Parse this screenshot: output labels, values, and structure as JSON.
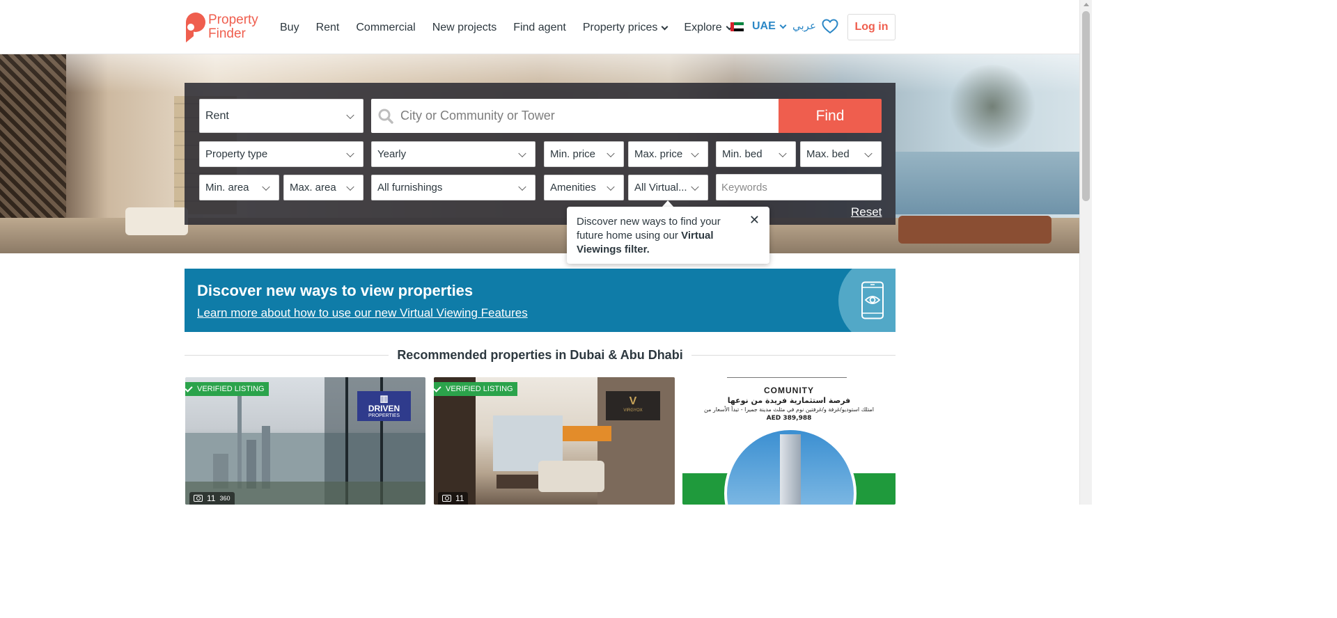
{
  "header": {
    "logo": {
      "line1": "Property",
      "line2": "Finder"
    },
    "nav": [
      {
        "label": "Buy",
        "dropdown": false
      },
      {
        "label": "Rent",
        "dropdown": false
      },
      {
        "label": "Commercial",
        "dropdown": false
      },
      {
        "label": "New projects",
        "dropdown": false
      },
      {
        "label": "Find agent",
        "dropdown": false
      },
      {
        "label": "Property prices",
        "dropdown": true
      },
      {
        "label": "Explore",
        "dropdown": true
      }
    ],
    "country": "UAE",
    "language": "عربي",
    "favorites_icon": "heart-icon",
    "login": "Log in"
  },
  "search": {
    "category": "Rent",
    "location_placeholder": "City or Community or Tower",
    "find": "Find",
    "property_type": "Property type",
    "period": "Yearly",
    "min_price": "Min. price",
    "max_price": "Max. price",
    "min_bed": "Min. bed",
    "max_bed": "Max. bed",
    "min_area": "Min. area",
    "max_area": "Max. area",
    "furnishings": "All furnishings",
    "amenities": "Amenities",
    "virtual": "All Virtual...",
    "keywords_placeholder": "Keywords",
    "reset": "Reset"
  },
  "tooltip": {
    "text": "Discover new ways to find your future home using our ",
    "bold": "Virtual Viewings filter.",
    "close": "✕"
  },
  "banner": {
    "title": "Discover new ways to view properties",
    "link": "Learn more about how to use our new Virtual Viewing Features",
    "icon": "phone-eye-icon"
  },
  "recommended": {
    "title": "Recommended properties in Dubai & Abu Dhabi",
    "cards": [
      {
        "badge": "VERIFIED LISTING",
        "agency": "DRIVEN",
        "agency_sub": "PROPERTIES",
        "photos": "11",
        "tour": "360"
      },
      {
        "badge": "VERIFIED LISTING",
        "agency": "VIRGYOX",
        "photos": "11"
      },
      {
        "ad_title": "COMUNITY",
        "ad_line1": "فرصة استثمارية فريدة من نوعها",
        "ad_line2": "امتلك استوديو/غرفة و/غرفتين نوم في مثلث مدينة جميرا - تبدأ الأسعار من",
        "ad_price": "AED 389,988"
      }
    ]
  },
  "colors": {
    "brand": "#ef5e4e",
    "link": "#2b87c6",
    "banner": "#0f7ca8",
    "verified": "#2ba34b"
  }
}
